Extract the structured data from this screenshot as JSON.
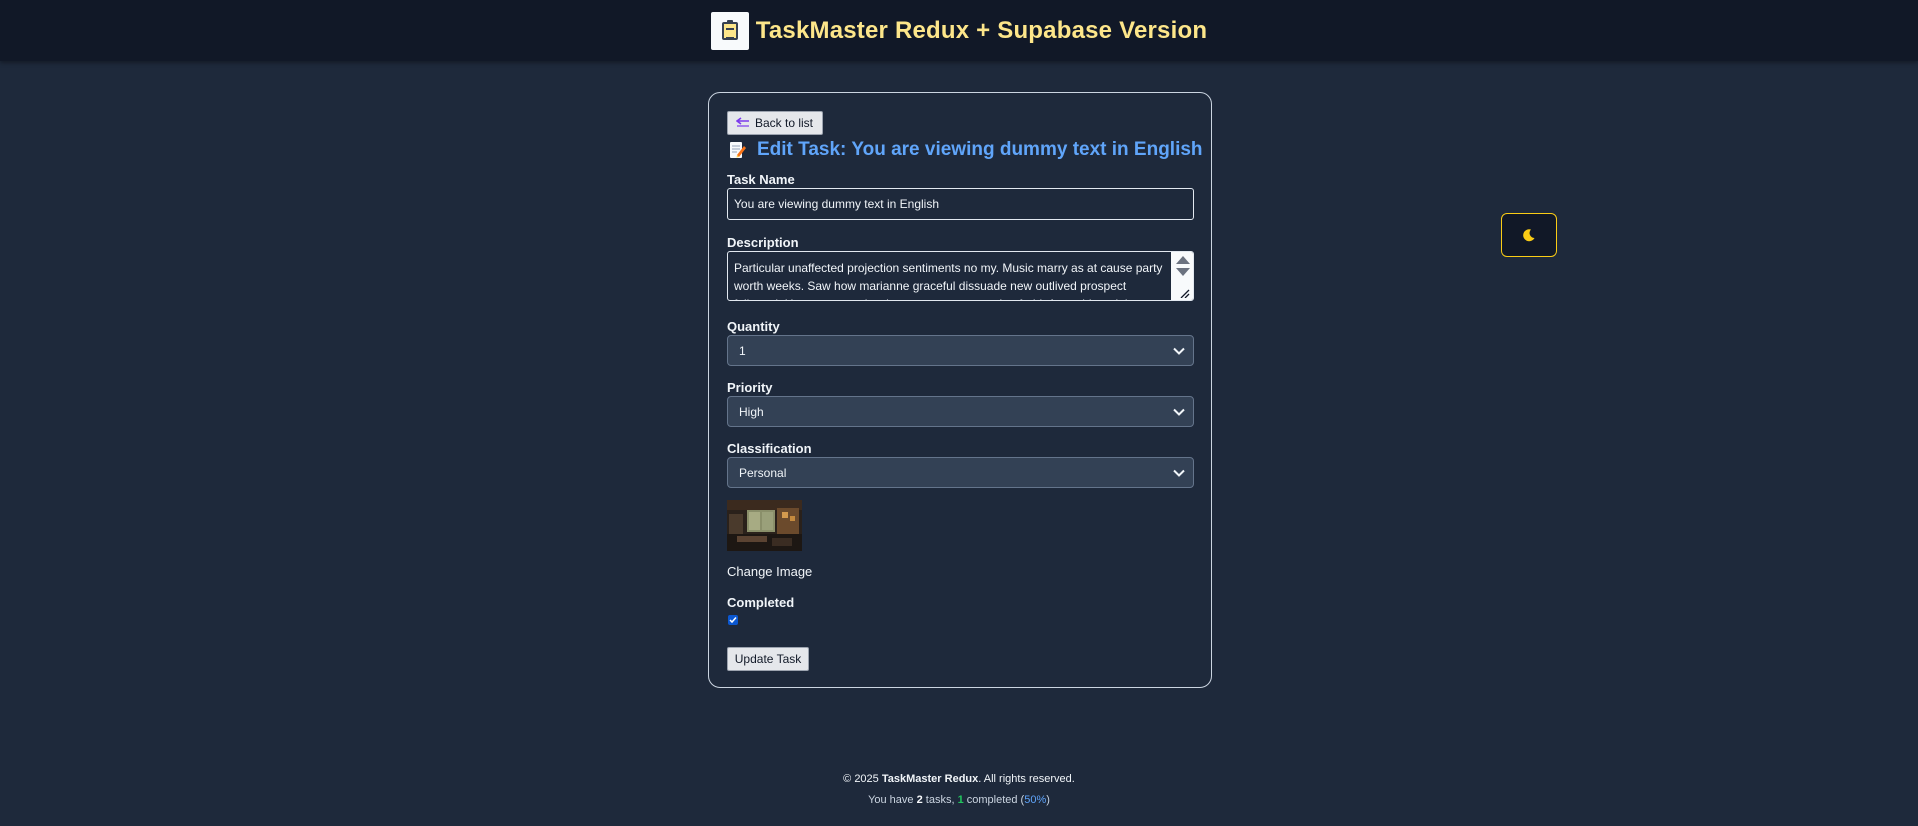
{
  "header": {
    "title": "TaskMaster Redux + Supabase Version",
    "logo_text": "TaskMaster Redux"
  },
  "form": {
    "back_label": "Back to list",
    "heading": "Edit Task: You are viewing dummy text in English",
    "task_name": {
      "label": "Task Name",
      "value": "You are viewing dummy text in English"
    },
    "description": {
      "label": "Description",
      "value": "Particular unaffected projection sentiments no my. Music marry as at cause party worth weeks. Saw how marianne graceful dissuade new outlived prospect followed. Uneasy no settle whence nature narrow in afraid. At could merit by keeps child."
    },
    "quantity": {
      "label": "Quantity",
      "value": "1"
    },
    "priority": {
      "label": "Priority",
      "value": "High"
    },
    "classification": {
      "label": "Classification",
      "value": "Personal"
    },
    "change_image_label": "Change Image",
    "completed": {
      "label": "Completed",
      "checked": true
    },
    "update_label": "Update Task"
  },
  "theme_toggle": {
    "icon": "moon-icon"
  },
  "footer": {
    "copyright_prefix": "© 2025 ",
    "brand": "TaskMaster Redux",
    "copyright_suffix": ". All rights reserved.",
    "stats_prefix": "You have ",
    "total_tasks": "2",
    "stats_mid1": " tasks, ",
    "completed_tasks": "1",
    "stats_mid2": " completed (",
    "percent": "50%",
    "stats_suffix": ")"
  },
  "colors": {
    "background": "#1e293b",
    "header_bg": "#111827",
    "title_yellow": "#fde68a",
    "heading_blue": "#60a5fa",
    "toggle_border": "#facc15"
  }
}
